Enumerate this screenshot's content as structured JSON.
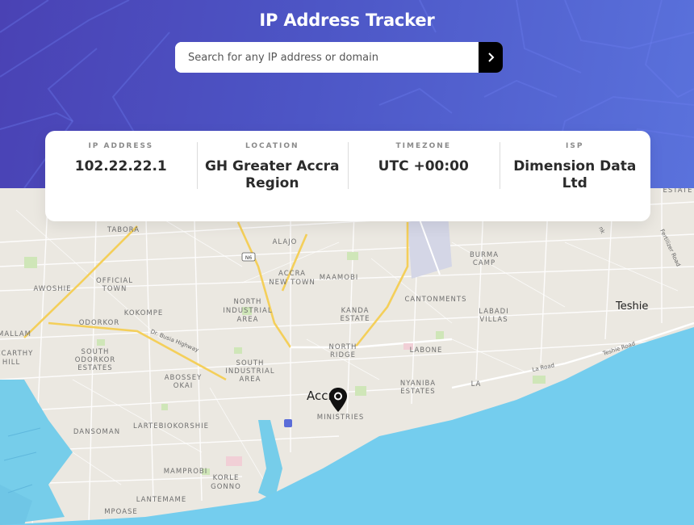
{
  "app": {
    "title": "IP Address Tracker"
  },
  "search": {
    "placeholder": "Search for any IP address or domain",
    "value": ""
  },
  "info": {
    "ip_label": "IP ADDRESS",
    "ip_value": "102.22.22.1",
    "location_label": "LOCATION",
    "location_value": "GH Greater Accra Region",
    "timezone_label": "TIMEZONE",
    "timezone_value": "UTC +00:00",
    "isp_label": "ISP",
    "isp_value": "Dimension Data Ltd"
  },
  "map": {
    "labels": {
      "tabora": "TABORA",
      "alajo": "ALAJO",
      "n6": "N6",
      "accra_new_town_1": "ACCRA",
      "accra_new_town_2": "NEW TOWN",
      "maamobi": "MAAMOBI",
      "burma_camp_1": "BURMA",
      "burma_camp_2": "CAMP",
      "official_town_1": "OFFICIAL",
      "official_town_2": "TOWN",
      "awoshie": "AWOSHIE",
      "north_ind_1": "NORTH",
      "north_ind_2": "INDUSTRIAL",
      "north_ind_3": "AREA",
      "kokompe": "KOKOMPE",
      "kanda_1": "KANDA",
      "kanda_2": "ESTATE",
      "cantonments": "CANTONMENTS",
      "labadi_1": "LABADI",
      "labadi_2": "VILLAS",
      "teshie": "Teshie",
      "odorkor": "ODORKOR",
      "mallam": "MALLAM",
      "mccarthy_1": "CCARTHY",
      "mccarthy_2": "HILL",
      "south_odorkor_1": "SOUTH",
      "south_odorkor_2": "ODORKOR",
      "south_odorkor_3": "ESTATES",
      "dr_busia": "Dr. Busia Highway",
      "north_ridge_1": "NORTH",
      "north_ridge_2": "RIDGE",
      "labone": "LABONE",
      "south_ind_1": "SOUTH",
      "south_ind_2": "INDUSTRIAL",
      "south_ind_3": "AREA",
      "abossey_1": "ABOSSEY",
      "abossey_2": "OKAI",
      "la_road": "La Road",
      "teshie_road": "Teshie Road",
      "nyaniba_1": "NYANIBA",
      "nyaniba_2": "ESTATES",
      "la": "LA",
      "accra": "Accra",
      "ministries": "MINISTRIES",
      "lartebiokorshie": "LARTEBIOKORSHIE",
      "dansoman": "DANSOMAN",
      "mamprobi": "MAMPROBI",
      "korle_1": "KORLE",
      "korle_2": "GONNO",
      "lantemame": "LANTEMAME",
      "mpoase": "MPOASE",
      "estate": "ESTATE",
      "ferlizer": "Fertilizer Road",
      "nk": "nk"
    }
  }
}
